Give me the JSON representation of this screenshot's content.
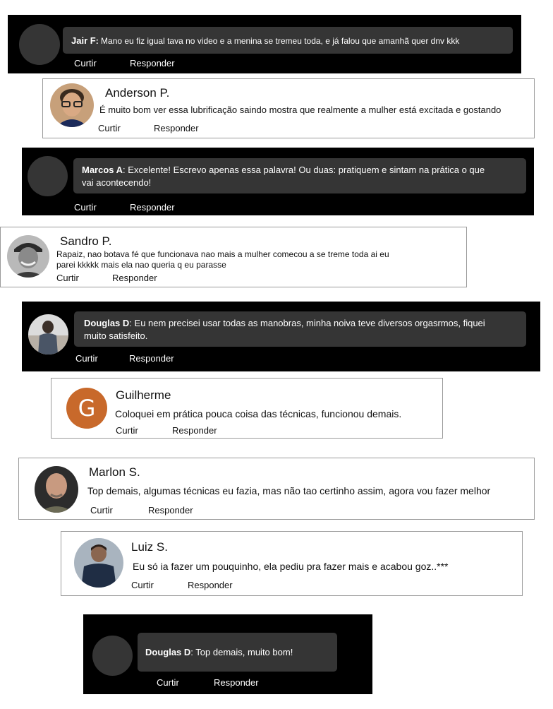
{
  "actions": {
    "like": "Curtir",
    "reply": "Responder"
  },
  "comments": [
    {
      "name": "Jair F",
      "sep": ": ",
      "text": "Mano eu fiz igual tava no video e a menina se tremeu toda, e já falou que amanhã quer dnv kkk"
    },
    {
      "name": "Anderson P.",
      "text": "É muito bom ver essa lubrificação saindo mostra que realmente a mulher está excitada e gostando"
    },
    {
      "name": "Marcos A",
      "sep": ": ",
      "text_line1": "Excelente! Escrevo apenas essa palavra! Ou duas: pratiquem e sintam na prática o que",
      "text_line2": "vai acontecendo!"
    },
    {
      "name": "Sandro P.",
      "text_line1": "Rapaiz, nao botava fé que funcionava nao mais a mulher comecou a se treme toda ai eu",
      "text_line2": "parei kkkkk mais ela nao queria q eu parasse"
    },
    {
      "name": "Douglas D",
      "sep": ": ",
      "text_line1": "Eu nem precisei usar todas as manobras, minha noiva teve diversos orgasrmos, fiquei",
      "text_line2": "muito satisfeito."
    },
    {
      "name": "Guilherme",
      "avatar_letter": "G",
      "avatar_color": "#c8692b",
      "text": "Coloquei em prática pouca coisa das técnicas, funcionou demais."
    },
    {
      "name": "Marlon S.",
      "text": "Top demais, algumas técnicas eu fazia, mas não tao certinho assim, agora vou fazer melhor"
    },
    {
      "name": "Luiz S.",
      "text": "Eu só ia fazer um pouquinho, ela pediu pra fazer mais e acabou goz..***"
    },
    {
      "name": "Douglas D",
      "sep": ": ",
      "text": "Top demais, muito bom!"
    }
  ]
}
